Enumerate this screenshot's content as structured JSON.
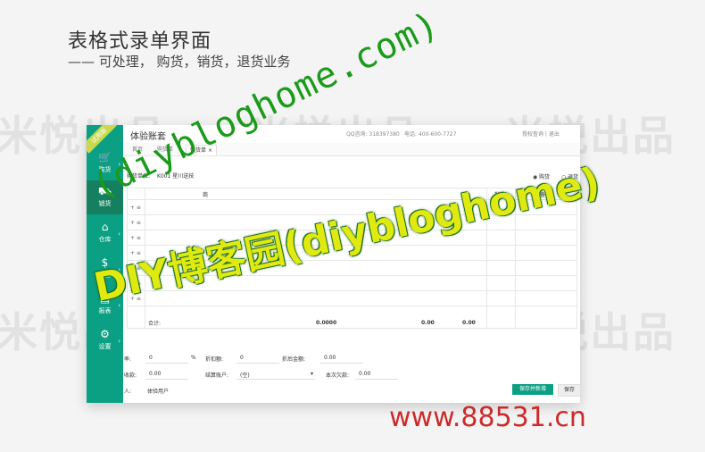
{
  "header": {
    "title": "表格式录单界面",
    "subtitle": "—— 可处理， 购货，销货，退货业务"
  },
  "watermark_bg": "米悦出品",
  "app": {
    "trial_badge": "试用版",
    "account_title": "体验账套",
    "qq": "QQ咨询: 318397380",
    "phone": "电话: 400-600-7727",
    "links": "授权查询 | 退出",
    "tabs": [
      "首页",
      "购货单",
      "销货单"
    ],
    "sidebar": [
      {
        "label": "购货",
        "icon": "cart-icon"
      },
      {
        "label": "销货",
        "icon": "cart-out-icon"
      },
      {
        "label": "仓库",
        "icon": "warehouse-icon"
      },
      {
        "label": "资金",
        "icon": "money-icon"
      },
      {
        "label": "报表",
        "icon": "report-icon"
      },
      {
        "label": "设置",
        "icon": "gear-icon"
      }
    ],
    "form": {
      "customer_label": "购货单位:",
      "customer_value": "K001 星川送技",
      "radio1": "购货",
      "radio2": "退货"
    },
    "grid": {
      "headers": [
        "商",
        "批量",
        "备注"
      ],
      "rows": [
        "+ ≡",
        "+ ≡",
        "+ ≡",
        "+ ≡",
        "+ ≡",
        "+ ≡",
        "+ ≡"
      ],
      "total_label": "合计:",
      "totals": [
        "0.0000",
        "0.00",
        "0.00"
      ]
    },
    "bottom": {
      "discount_label": "率:",
      "discount_value": "0",
      "pct": "%",
      "disc_amount_label": "折扣额:",
      "disc_amount_value": "0",
      "after_label": "折后金额:",
      "after_value": "0.00",
      "paid_label": "收款:",
      "paid_value": "0.00",
      "account_label": "结算账户:",
      "account_value": "(空)",
      "this_label": "本次欠款:",
      "this_value": "0.00",
      "maker_label": "人:",
      "maker_value": "体验用户",
      "save_new": "保存并新增",
      "save": "保存"
    }
  },
  "overlay": {
    "blog_url": "(diybloghome.com)",
    "blog_name": "DIY博客园(diybloghome)",
    "footer": "www.88531.cn"
  }
}
